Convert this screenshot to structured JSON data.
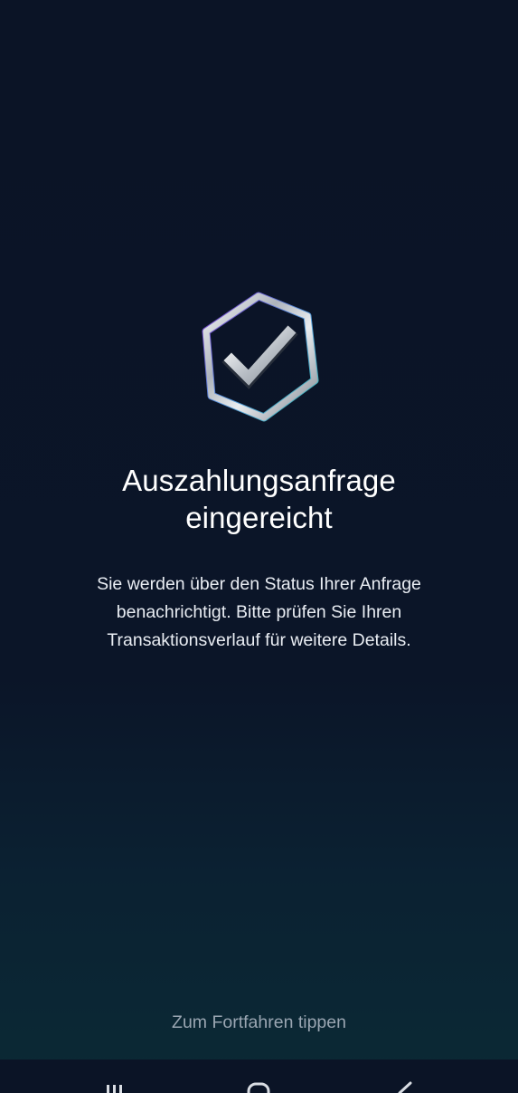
{
  "status": {
    "icon": "shield-check-icon",
    "title_line1": "Auszahlungsanfrage",
    "title_line2": "eingereicht",
    "message": "Sie werden über den Status Ihrer Anfrage benachrichtigt. Bitte prüfen Sie Ihren Transaktionsverlauf für weitere Details."
  },
  "actions": {
    "continue_label": "Zum Fortfahren tippen"
  },
  "system_nav": {
    "recents_icon": "recents-icon",
    "home_icon": "home-icon",
    "back_icon": "back-icon"
  },
  "colors": {
    "background": "#0b1426",
    "background_bottom": "#0b2a35",
    "title": "#ffffff",
    "body_text": "#e9edf3",
    "muted_text": "#9aa6b2"
  }
}
